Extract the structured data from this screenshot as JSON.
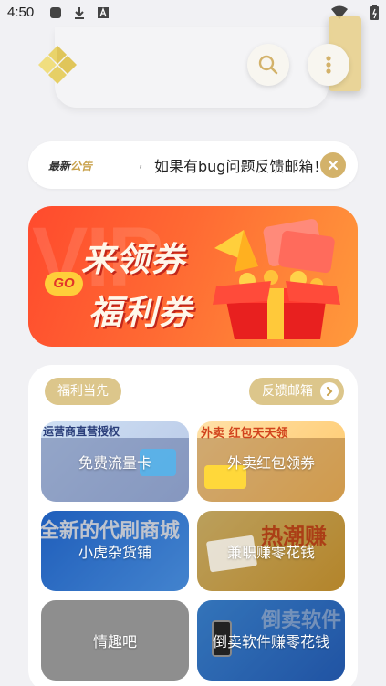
{
  "status_bar": {
    "time": "4:50"
  },
  "notice": {
    "tag_prefix": "最新",
    "tag_suffix": "公告",
    "separator": ",",
    "text": "如果有bug问题反馈邮箱！"
  },
  "banner": {
    "watermark": "VIP",
    "line1": "来领券",
    "line2": "福利券",
    "go": "GO"
  },
  "panel": {
    "left_pill": "福利当先",
    "right_pill": "反馈邮箱",
    "tiles": [
      {
        "label": "免费流量卡",
        "deco": "运营商直营授权"
      },
      {
        "label": "外卖红包领券",
        "deco": "外卖 红包天天领"
      },
      {
        "label": "小虎杂货铺",
        "deco": "全新的代刷商城"
      },
      {
        "label": "兼职赚零花钱",
        "deco": "热潮赚"
      },
      {
        "label": "情趣吧",
        "deco": ""
      },
      {
        "label": "倒卖软件赚零花钱",
        "deco": "倒卖软件"
      }
    ]
  },
  "colors": {
    "accent_gold": "#d3b26a",
    "pill_gold": "#dcc68b",
    "banner_red": "#ff4a2d",
    "background": "#f1f1f4"
  },
  "icons": [
    "notification-square-icon",
    "download-icon",
    "a-badge-icon",
    "wifi-icon",
    "battery-icon",
    "diamond-logo-icon",
    "search-icon",
    "more-vertical-icon",
    "close-icon",
    "chevron-right-icon"
  ]
}
